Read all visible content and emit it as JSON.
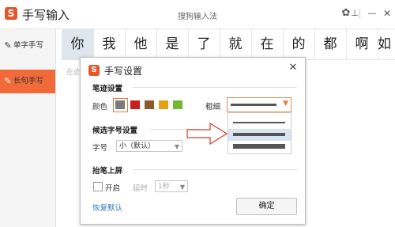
{
  "app": {
    "logo_letter": "S",
    "title": "手写输入",
    "window_title": "搜狗输入法",
    "gear_glyph": "✿",
    "pin_glyph": "⊥",
    "min_glyph": "—",
    "close_glyph": "✕"
  },
  "sidebar": {
    "items": [
      {
        "icon": "✎",
        "label": "单字手写",
        "active": false
      },
      {
        "icon": "✎",
        "label": "长句手写",
        "active": true
      }
    ]
  },
  "candidates": [
    "你",
    "我",
    "他",
    "是",
    "了",
    "就",
    "在",
    "的",
    "都",
    "啊",
    "如"
  ],
  "input_hint": "在此",
  "dialog": {
    "logo_letter": "S",
    "title": "手写设置",
    "close_glyph": "✕",
    "stroke_section": "笔迹设置",
    "color_label": "颜色",
    "colors": [
      "#7a7a7a",
      "#c8211c",
      "#8a5a2c",
      "#e2a014",
      "#6fb92e"
    ],
    "thickness_label": "粗细",
    "thickness_options": [
      "细",
      "中",
      "粗"
    ],
    "candidate_section": "候选字号设置",
    "font_size_label": "字号",
    "font_size_value": "小（默认）",
    "lift_section": "抬笔上屏",
    "enable_label": "开启",
    "delay_label": "延时",
    "delay_value": "1秒",
    "reset_link": "恢复默认",
    "ok_button": "确定"
  },
  "annotation": {
    "color": "#d93a2b"
  }
}
